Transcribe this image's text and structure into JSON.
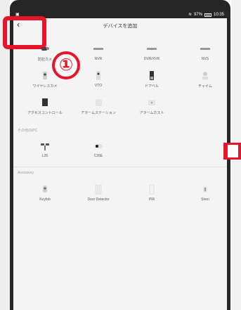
{
  "status_bar": {
    "right_text": "97%",
    "time": "10:35"
  },
  "header": {
    "title": "デバイスを追加",
    "back_icon": "chevron-left-icon"
  },
  "annotation": {
    "step_label": "①"
  },
  "device_rows": [
    [
      {
        "label": "防犯カメ",
        "icon": "camera-icon"
      },
      {
        "label": "NVR",
        "icon": "nvr-icon"
      },
      {
        "label": "DVR/XVR",
        "icon": "dvr-icon"
      },
      {
        "label": "NVS",
        "icon": "nvs-icon"
      }
    ],
    [
      {
        "label": "ワイヤレスカメ",
        "icon": "wireless-camera-icon"
      },
      {
        "label": "VTO",
        "icon": "intercom-icon"
      },
      {
        "label": "ドアベル",
        "icon": "doorbell-icon"
      },
      {
        "label": "チャイム",
        "icon": "chime-icon"
      }
    ],
    [
      {
        "label": "アクセスコントロール",
        "icon": "access-control-icon"
      },
      {
        "label": "アラームステーション",
        "icon": "alarm-station-icon"
      },
      {
        "label": "アラームホスト",
        "icon": "alarm-host-icon"
      }
    ]
  ],
  "ipc_section": {
    "title": "その他のIPC",
    "items": [
      {
        "label": "L26",
        "icon": "dual-camera-icon"
      },
      {
        "label": "C26E",
        "icon": "bullet-camera-icon"
      }
    ]
  },
  "accessory_section": {
    "title": "Accessory",
    "items": [
      {
        "label": "Keyfob",
        "icon": "keyfob-icon"
      },
      {
        "label": "Door Detector",
        "icon": "door-detector-icon"
      },
      {
        "label": "PIR",
        "icon": "pir-icon"
      },
      {
        "label": "Siren",
        "icon": "siren-icon"
      }
    ]
  },
  "colors": {
    "highlight": "#e8142a",
    "background": "#f4f4f4",
    "frame": "#262626"
  }
}
